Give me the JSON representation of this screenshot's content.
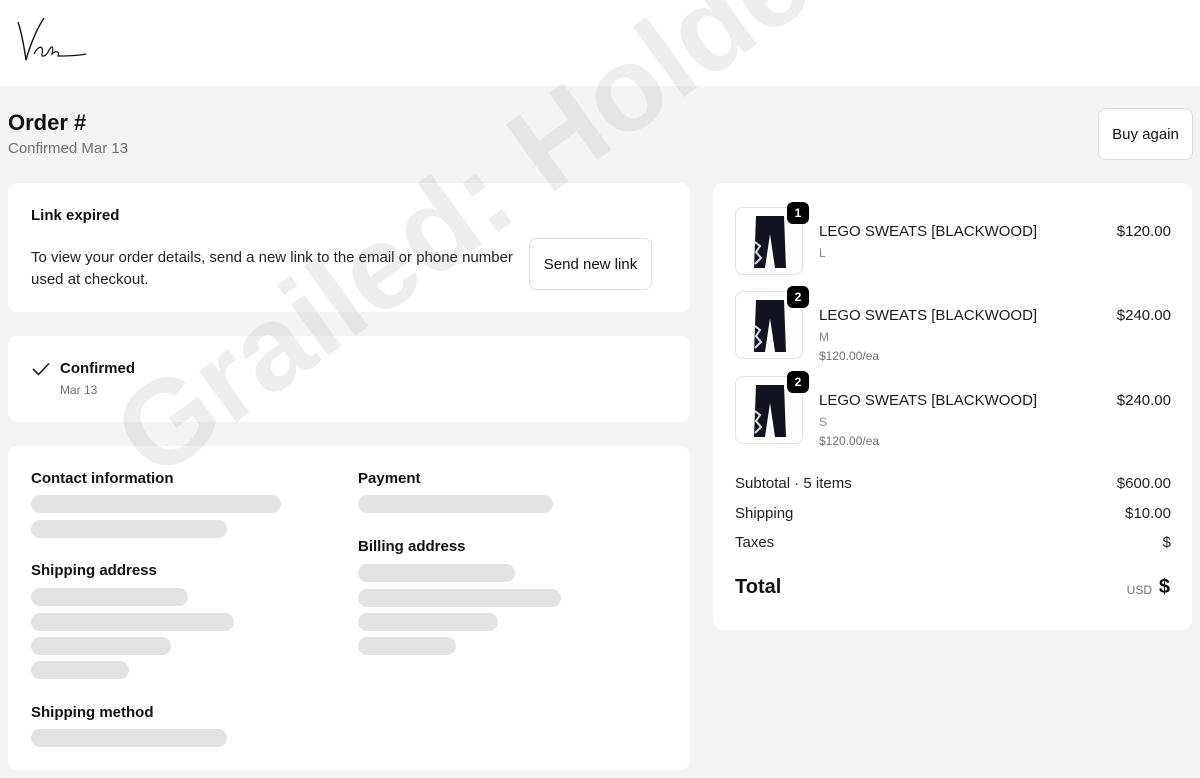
{
  "brand": {
    "logo_icon": "signature-logo-icon"
  },
  "order": {
    "title": "Order #",
    "confirmed_date": "Confirmed Mar 13",
    "buy_again_label": "Buy again"
  },
  "link_notice": {
    "title": "Link expired",
    "body": "To view your order details, send a new link to the email or phone number used at checkout.",
    "button_label": "Send new link"
  },
  "status": {
    "icon": "check-icon",
    "label": "Confirmed",
    "date": "Mar 13"
  },
  "info": {
    "contact_heading": "Contact information",
    "payment_heading": "Payment",
    "shipping_address_heading": "Shipping address",
    "billing_address_heading": "Billing address",
    "shipping_method_heading": "Shipping method"
  },
  "items": [
    {
      "name": "LEGO SWEATS [BLACKWOOD]",
      "variant": "L",
      "unit_price": "",
      "price": "$120.00",
      "quantity": "1"
    },
    {
      "name": "LEGO SWEATS [BLACKWOOD]",
      "variant": "M",
      "unit_price": "$120.00/ea",
      "price": "$240.00",
      "quantity": "2"
    },
    {
      "name": "LEGO SWEATS [BLACKWOOD]",
      "variant": "S",
      "unit_price": "$120.00/ea",
      "price": "$240.00",
      "quantity": "2"
    }
  ],
  "summary": {
    "subtotal_label": "Subtotal · 5 items",
    "subtotal_value": "$600.00",
    "shipping_label": "Shipping",
    "shipping_value": "$10.00",
    "taxes_label": "Taxes",
    "taxes_value": "$",
    "total_label": "Total",
    "total_currency": "USD",
    "total_value": "$"
  },
  "watermark": "Grailed: Holdenmm",
  "colors": {
    "background": "#f4f4f4",
    "card": "#ffffff",
    "skeleton": "#e3e3e3",
    "badge": "#000000"
  }
}
